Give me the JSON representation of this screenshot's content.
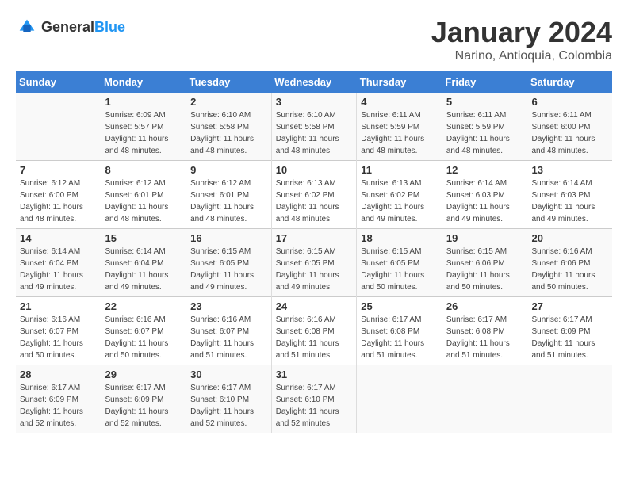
{
  "header": {
    "logo_general": "General",
    "logo_blue": "Blue",
    "title": "January 2024",
    "subtitle": "Narino, Antioquia, Colombia"
  },
  "days_of_week": [
    "Sunday",
    "Monday",
    "Tuesday",
    "Wednesday",
    "Thursday",
    "Friday",
    "Saturday"
  ],
  "weeks": [
    [
      {
        "day": "",
        "info": ""
      },
      {
        "day": "1",
        "info": "Sunrise: 6:09 AM\nSunset: 5:57 PM\nDaylight: 11 hours\nand 48 minutes."
      },
      {
        "day": "2",
        "info": "Sunrise: 6:10 AM\nSunset: 5:58 PM\nDaylight: 11 hours\nand 48 minutes."
      },
      {
        "day": "3",
        "info": "Sunrise: 6:10 AM\nSunset: 5:58 PM\nDaylight: 11 hours\nand 48 minutes."
      },
      {
        "day": "4",
        "info": "Sunrise: 6:11 AM\nSunset: 5:59 PM\nDaylight: 11 hours\nand 48 minutes."
      },
      {
        "day": "5",
        "info": "Sunrise: 6:11 AM\nSunset: 5:59 PM\nDaylight: 11 hours\nand 48 minutes."
      },
      {
        "day": "6",
        "info": "Sunrise: 6:11 AM\nSunset: 6:00 PM\nDaylight: 11 hours\nand 48 minutes."
      }
    ],
    [
      {
        "day": "7",
        "info": "Sunrise: 6:12 AM\nSunset: 6:00 PM\nDaylight: 11 hours\nand 48 minutes."
      },
      {
        "day": "8",
        "info": "Sunrise: 6:12 AM\nSunset: 6:01 PM\nDaylight: 11 hours\nand 48 minutes."
      },
      {
        "day": "9",
        "info": "Sunrise: 6:12 AM\nSunset: 6:01 PM\nDaylight: 11 hours\nand 48 minutes."
      },
      {
        "day": "10",
        "info": "Sunrise: 6:13 AM\nSunset: 6:02 PM\nDaylight: 11 hours\nand 48 minutes."
      },
      {
        "day": "11",
        "info": "Sunrise: 6:13 AM\nSunset: 6:02 PM\nDaylight: 11 hours\nand 49 minutes."
      },
      {
        "day": "12",
        "info": "Sunrise: 6:14 AM\nSunset: 6:03 PM\nDaylight: 11 hours\nand 49 minutes."
      },
      {
        "day": "13",
        "info": "Sunrise: 6:14 AM\nSunset: 6:03 PM\nDaylight: 11 hours\nand 49 minutes."
      }
    ],
    [
      {
        "day": "14",
        "info": "Sunrise: 6:14 AM\nSunset: 6:04 PM\nDaylight: 11 hours\nand 49 minutes."
      },
      {
        "day": "15",
        "info": "Sunrise: 6:14 AM\nSunset: 6:04 PM\nDaylight: 11 hours\nand 49 minutes."
      },
      {
        "day": "16",
        "info": "Sunrise: 6:15 AM\nSunset: 6:05 PM\nDaylight: 11 hours\nand 49 minutes."
      },
      {
        "day": "17",
        "info": "Sunrise: 6:15 AM\nSunset: 6:05 PM\nDaylight: 11 hours\nand 49 minutes."
      },
      {
        "day": "18",
        "info": "Sunrise: 6:15 AM\nSunset: 6:05 PM\nDaylight: 11 hours\nand 50 minutes."
      },
      {
        "day": "19",
        "info": "Sunrise: 6:15 AM\nSunset: 6:06 PM\nDaylight: 11 hours\nand 50 minutes."
      },
      {
        "day": "20",
        "info": "Sunrise: 6:16 AM\nSunset: 6:06 PM\nDaylight: 11 hours\nand 50 minutes."
      }
    ],
    [
      {
        "day": "21",
        "info": "Sunrise: 6:16 AM\nSunset: 6:07 PM\nDaylight: 11 hours\nand 50 minutes."
      },
      {
        "day": "22",
        "info": "Sunrise: 6:16 AM\nSunset: 6:07 PM\nDaylight: 11 hours\nand 50 minutes."
      },
      {
        "day": "23",
        "info": "Sunrise: 6:16 AM\nSunset: 6:07 PM\nDaylight: 11 hours\nand 51 minutes."
      },
      {
        "day": "24",
        "info": "Sunrise: 6:16 AM\nSunset: 6:08 PM\nDaylight: 11 hours\nand 51 minutes."
      },
      {
        "day": "25",
        "info": "Sunrise: 6:17 AM\nSunset: 6:08 PM\nDaylight: 11 hours\nand 51 minutes."
      },
      {
        "day": "26",
        "info": "Sunrise: 6:17 AM\nSunset: 6:08 PM\nDaylight: 11 hours\nand 51 minutes."
      },
      {
        "day": "27",
        "info": "Sunrise: 6:17 AM\nSunset: 6:09 PM\nDaylight: 11 hours\nand 51 minutes."
      }
    ],
    [
      {
        "day": "28",
        "info": "Sunrise: 6:17 AM\nSunset: 6:09 PM\nDaylight: 11 hours\nand 52 minutes."
      },
      {
        "day": "29",
        "info": "Sunrise: 6:17 AM\nSunset: 6:09 PM\nDaylight: 11 hours\nand 52 minutes."
      },
      {
        "day": "30",
        "info": "Sunrise: 6:17 AM\nSunset: 6:10 PM\nDaylight: 11 hours\nand 52 minutes."
      },
      {
        "day": "31",
        "info": "Sunrise: 6:17 AM\nSunset: 6:10 PM\nDaylight: 11 hours\nand 52 minutes."
      },
      {
        "day": "",
        "info": ""
      },
      {
        "day": "",
        "info": ""
      },
      {
        "day": "",
        "info": ""
      }
    ]
  ]
}
